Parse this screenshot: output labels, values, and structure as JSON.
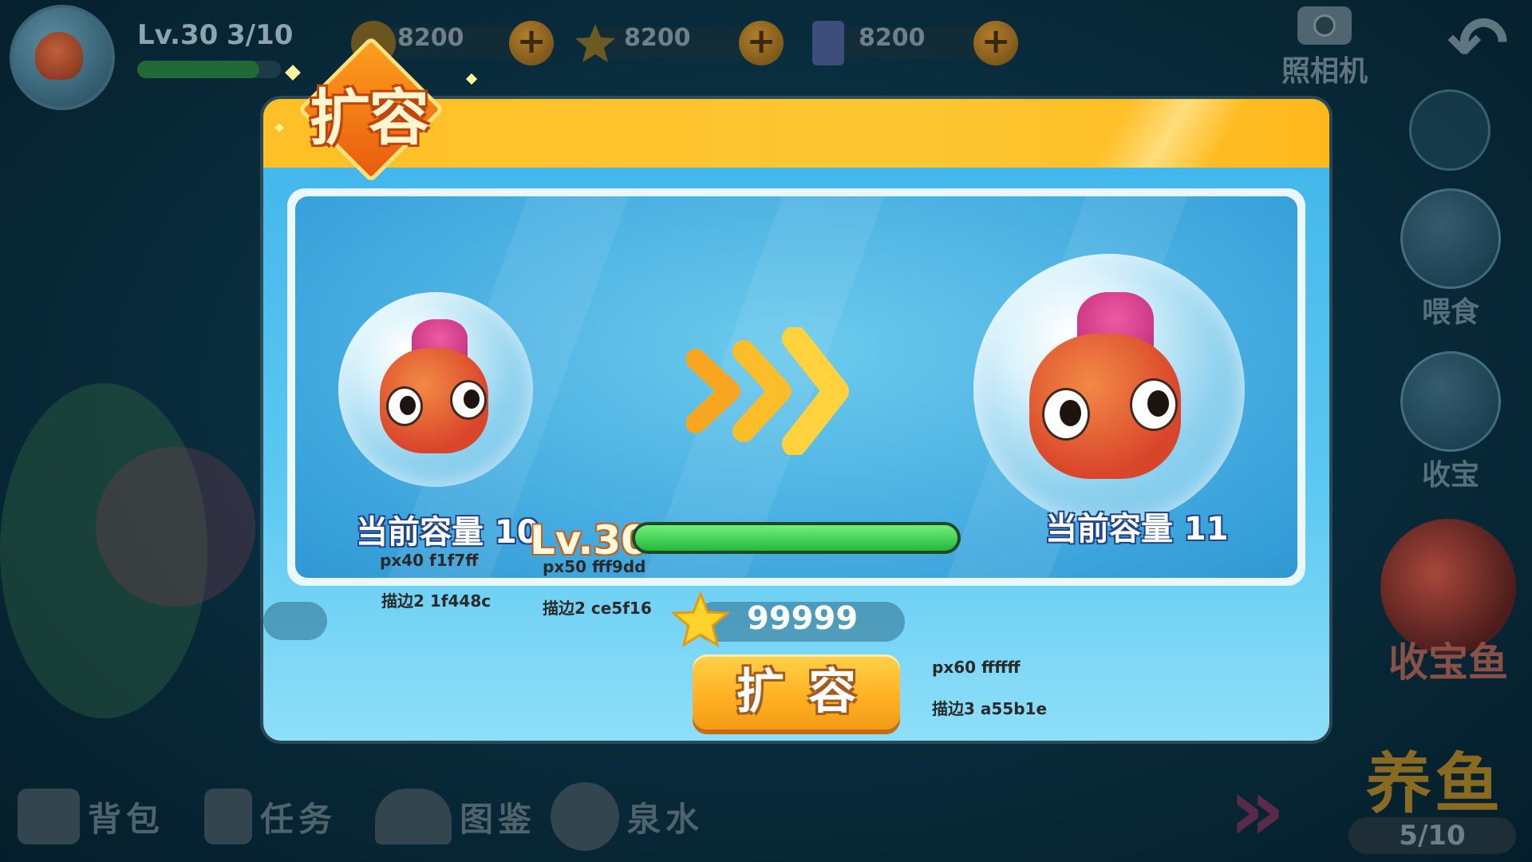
{
  "hud": {
    "level": "Lv.30",
    "fish_count": "3/10",
    "xp_fraction": 0.85,
    "resources": [
      {
        "icon": "coin-icon",
        "value": "8200"
      },
      {
        "icon": "star-icon",
        "value": "8200"
      },
      {
        "icon": "card-icon",
        "value": "8200"
      }
    ],
    "camera_label": "照相机"
  },
  "side_menu": {
    "feed_label": "喂食",
    "collect_label": "收宝",
    "treasure_fish_label": "收宝鱼",
    "raise_fish_label": "养鱼",
    "raise_fish_count": "5/10"
  },
  "bottom_nav": [
    {
      "label": "背包",
      "icon": "backpack-icon"
    },
    {
      "label": "任务",
      "icon": "task-icon"
    },
    {
      "label": "图鉴",
      "icon": "handbook-icon"
    },
    {
      "label": "泉水",
      "icon": "spring-icon"
    }
  ],
  "dialog": {
    "title": "扩容",
    "current_capacity": "当前容量 10",
    "next_capacity": "当前容量 11",
    "level": "Lv.30",
    "level_progress": 1.0,
    "cost": "99999",
    "button_label": "扩容",
    "notes": {
      "cap_font": "px40 f1f7ff",
      "cap_stroke": "描边2 1f448c",
      "lv_font": "px50 fff9dd",
      "lv_stroke": "描边2 ce5f16",
      "btn_font": "px60 ffffff",
      "btn_stroke": "描边3 a55b1e"
    }
  },
  "colors": {
    "header_yellow": "#ffbf26",
    "panel_blue": "#46ade1",
    "button_orange": "#ffb323",
    "progress_green": "#25b83d"
  }
}
